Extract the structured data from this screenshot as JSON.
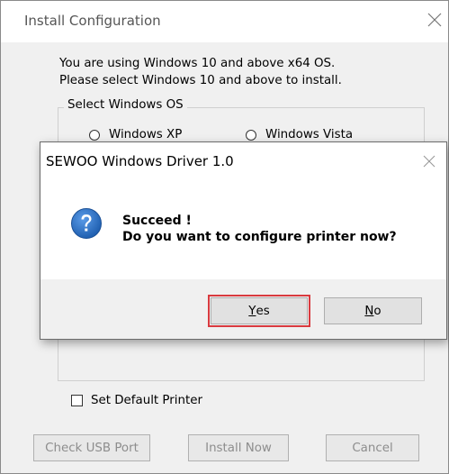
{
  "window": {
    "title": "Install Configuration",
    "intro_line1": "You are using Windows 10 and above x64 OS.",
    "intro_line2": "Please select Windows 10 and above to install.",
    "group_label": "Select Windows OS",
    "os_options": [
      "Windows XP",
      "Windows Vista"
    ],
    "set_default_label": "Set Default Printer",
    "buttons": {
      "check_usb": "Check USB Port",
      "install_now": "Install Now",
      "cancel": "Cancel"
    }
  },
  "dialog": {
    "title": "SEWOO Windows Driver 1.0",
    "message_line1": "Succeed !",
    "message_line2": "Do you want to configure printer now?",
    "yes_mnemonic": "Y",
    "yes_rest": "es",
    "no_mnemonic": "N",
    "no_rest": "o",
    "icon": "question-icon"
  },
  "colors": {
    "highlight": "#d93a3f",
    "icon_blue": "#1f5fb0"
  }
}
